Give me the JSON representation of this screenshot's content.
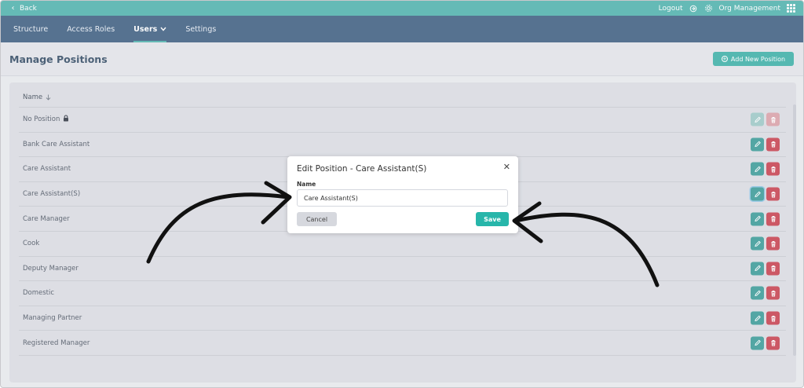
{
  "topbar": {
    "back_label": "Back",
    "logout_label": "Logout",
    "org_label": "Org Management"
  },
  "nav": {
    "items": [
      {
        "label": "Structure",
        "active": false
      },
      {
        "label": "Access Roles",
        "active": false
      },
      {
        "label": "Users",
        "active": true,
        "has_dropdown": true
      },
      {
        "label": "Settings",
        "active": false
      }
    ]
  },
  "page": {
    "title": "Manage Positions",
    "add_button_label": "Add New Position"
  },
  "table": {
    "column_header": "Name",
    "rows": [
      {
        "name": "No Position",
        "locked": true,
        "actions_disabled": true
      },
      {
        "name": "Bank Care Assistant"
      },
      {
        "name": "Care Assistant"
      },
      {
        "name": "Care Assistant(S)",
        "edit_focused": true
      },
      {
        "name": "Care Manager"
      },
      {
        "name": "Cook"
      },
      {
        "name": "Deputy Manager"
      },
      {
        "name": "Domestic"
      },
      {
        "name": "Managing Partner"
      },
      {
        "name": "Registered Manager"
      }
    ]
  },
  "modal": {
    "title": "Edit Position - Care Assistant(S)",
    "field_label": "Name",
    "field_value": "Care Assistant(S)",
    "cancel_label": "Cancel",
    "save_label": "Save"
  },
  "colors": {
    "topbar": "#4fb3ad",
    "nav": "#3e5f80",
    "accent": "#3db1a7",
    "edit": "#3a9c98",
    "delete": "#c8404e"
  },
  "icons": [
    "chevron-left-icon",
    "logout-icon",
    "gear-icon",
    "apps-grid-icon",
    "chevron-down-icon",
    "plus-circle-icon",
    "sort-down-icon",
    "lock-icon",
    "pencil-icon",
    "trash-icon",
    "close-icon"
  ]
}
